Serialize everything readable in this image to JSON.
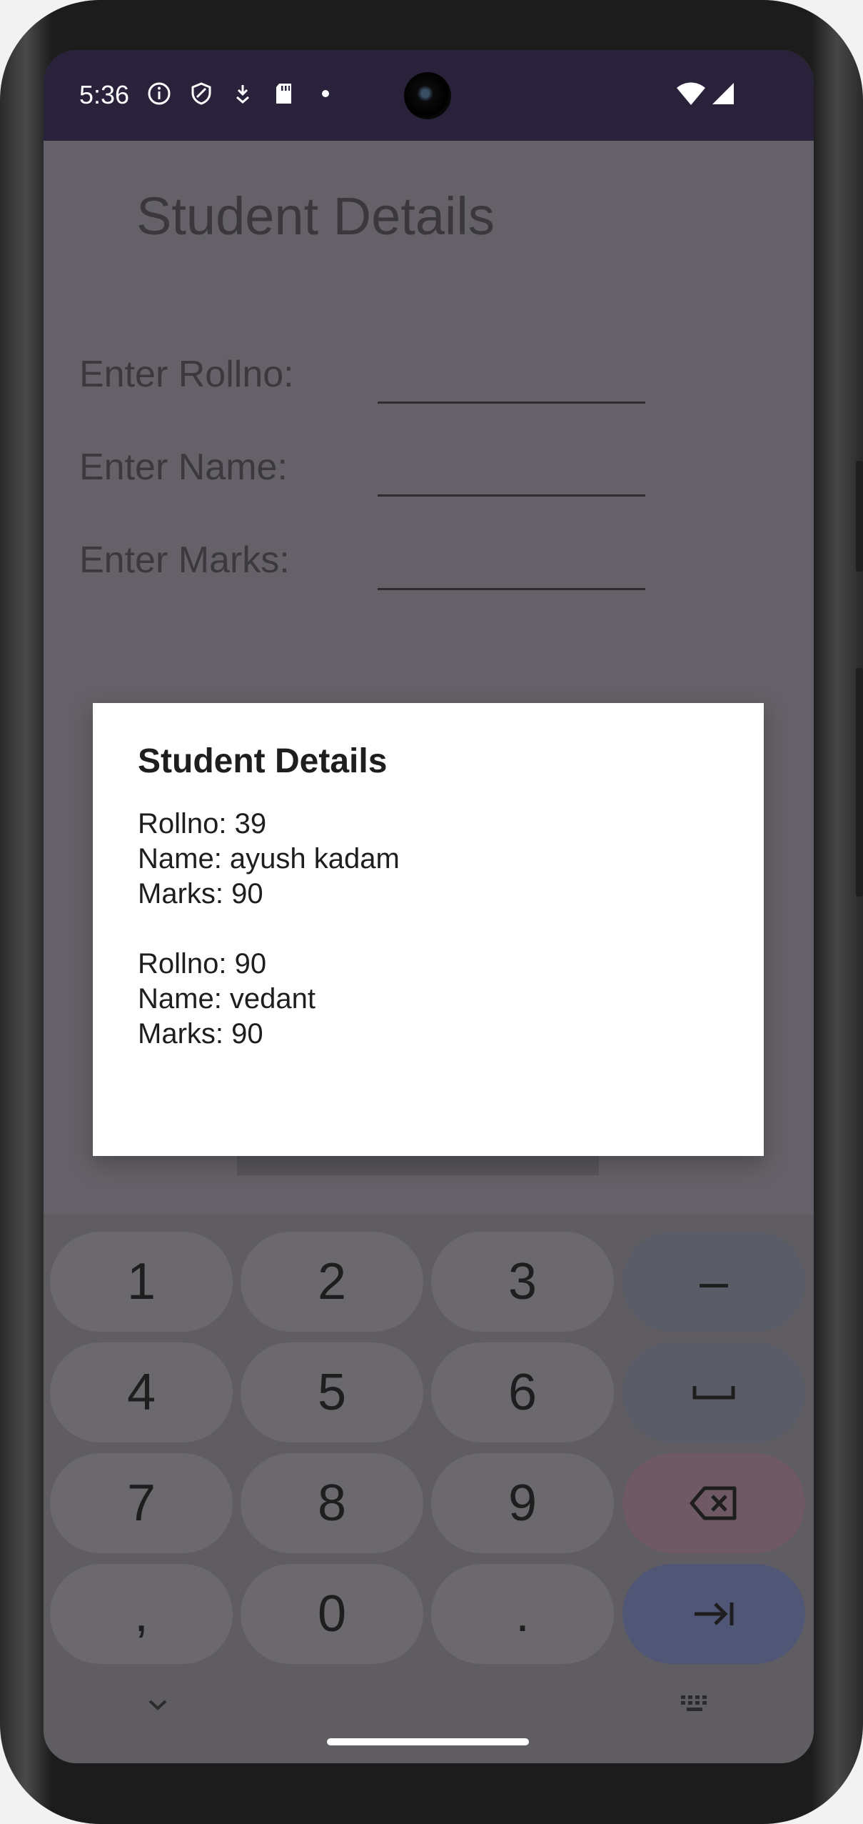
{
  "status_bar": {
    "time": "5:36",
    "left_icons": [
      "info-icon",
      "shield-icon",
      "download-icon",
      "sd-card-icon",
      "dot-icon"
    ],
    "right_icons": [
      "wifi-icon",
      "signal-icon"
    ]
  },
  "app": {
    "title": "Student Details",
    "fields": [
      {
        "label": "Enter Rollno:",
        "value": ""
      },
      {
        "label": "Enter Name:",
        "value": ""
      },
      {
        "label": "Enter Marks:",
        "value": ""
      }
    ]
  },
  "dialog": {
    "title": "Student Details",
    "records": [
      {
        "rollno": "Rollno: 39",
        "name": "Name: ayush kadam",
        "marks": "Marks: 90"
      },
      {
        "rollno": "Rollno: 90",
        "name": "Name: vedant",
        "marks": "Marks: 90"
      }
    ]
  },
  "keyboard": {
    "rows": [
      [
        "1",
        "2",
        "3",
        "–"
      ],
      [
        "4",
        "5",
        "6",
        "␣"
      ],
      [
        "7",
        "8",
        "9",
        "⌫"
      ],
      [
        ",",
        "0",
        ".",
        "⇥"
      ]
    ],
    "bottom_left_icon": "chevron-down-icon",
    "bottom_right_icon": "keyboard-icon"
  },
  "colors": {
    "status_bar": "#29223a",
    "scrim_background": "#646168",
    "dialog_background": "#ffffff",
    "enter_key": "#4f5676",
    "delete_key": "#6e5965"
  }
}
